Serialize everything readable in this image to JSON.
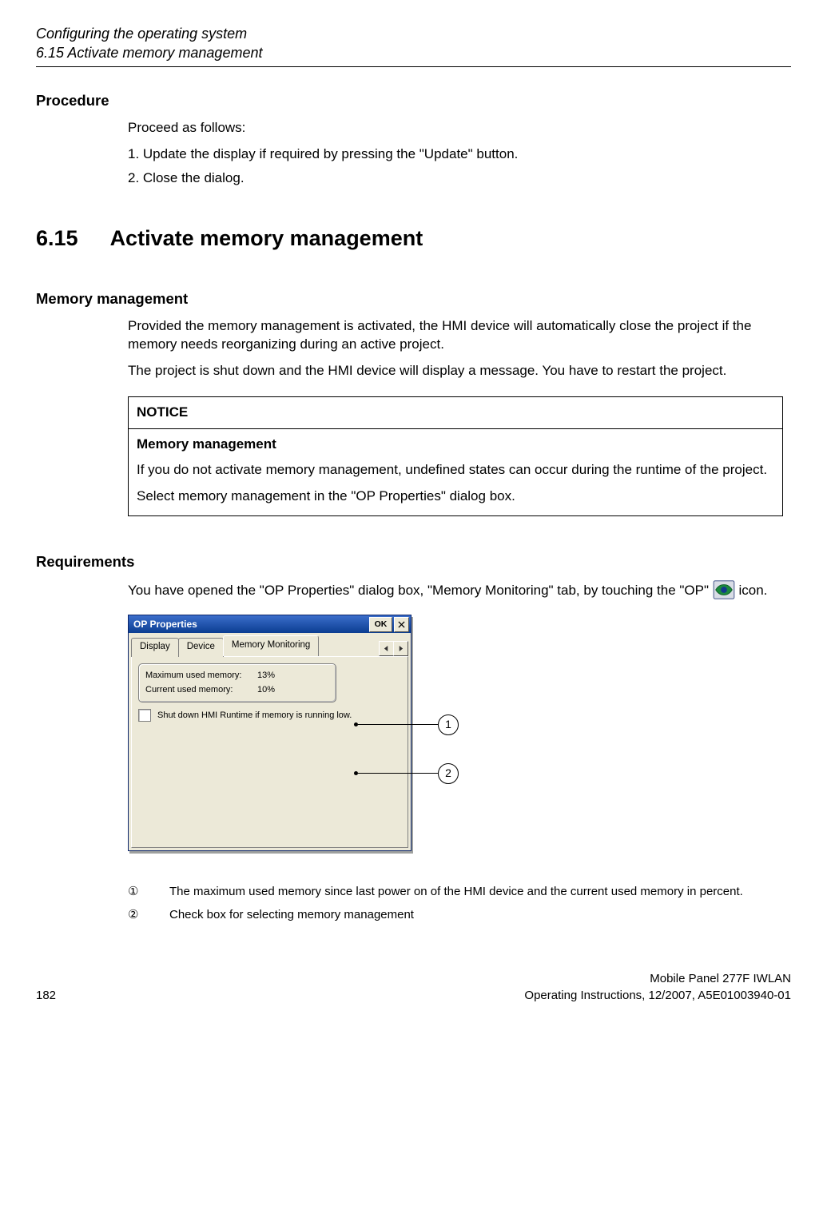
{
  "header": {
    "running_title": "Configuring the operating system",
    "section_ref": "6.15 Activate memory management"
  },
  "procedure": {
    "heading": "Procedure",
    "intro": "Proceed as follows:",
    "steps": [
      "1.  Update the display if required by pressing the \"Update\" button.",
      "2.  Close the dialog."
    ]
  },
  "main_heading": {
    "number": "6.15",
    "title": "Activate memory management"
  },
  "memory_mgmt": {
    "heading": "Memory management",
    "p1": "Provided the memory management is activated, the HMI device will automatically close the project if the memory needs reorganizing during an active project.",
    "p2": "The project is shut down and the HMI device will display a message. You have to restart the project."
  },
  "notice": {
    "label": "NOTICE",
    "subheading": "Memory management",
    "p1": "If you do not activate memory management, undefined states can occur during the runtime of the project.",
    "p2": "Select memory management in the \"OP Properties\" dialog box."
  },
  "requirements": {
    "heading": "Requirements",
    "text_pre": "You have opened the \"OP Properties\" dialog box, \"Memory Monitoring\" tab, by touching the \"OP\" ",
    "text_post": " icon."
  },
  "dialog": {
    "title": "OP Properties",
    "ok": "OK",
    "tabs": {
      "display": "Display",
      "device": "Device",
      "memmon": "Memory Monitoring"
    },
    "mem": {
      "max_label": "Maximum used memory:",
      "max_val": "13%",
      "cur_label": "Current used memory:",
      "cur_val": "10%"
    },
    "shutdown_label": "Shut down HMI Runtime if memory is running low."
  },
  "callouts": {
    "c1": "1",
    "c2": "2"
  },
  "legend": {
    "n1": "①",
    "t1": "The maximum used memory since last power on of the HMI device and the current used memory in percent.",
    "n2": "②",
    "t2": "Check box for selecting memory management"
  },
  "footer": {
    "page": "182",
    "r1": "Mobile Panel 277F IWLAN",
    "r2": "Operating Instructions, 12/2007, A5E01003940-01"
  }
}
